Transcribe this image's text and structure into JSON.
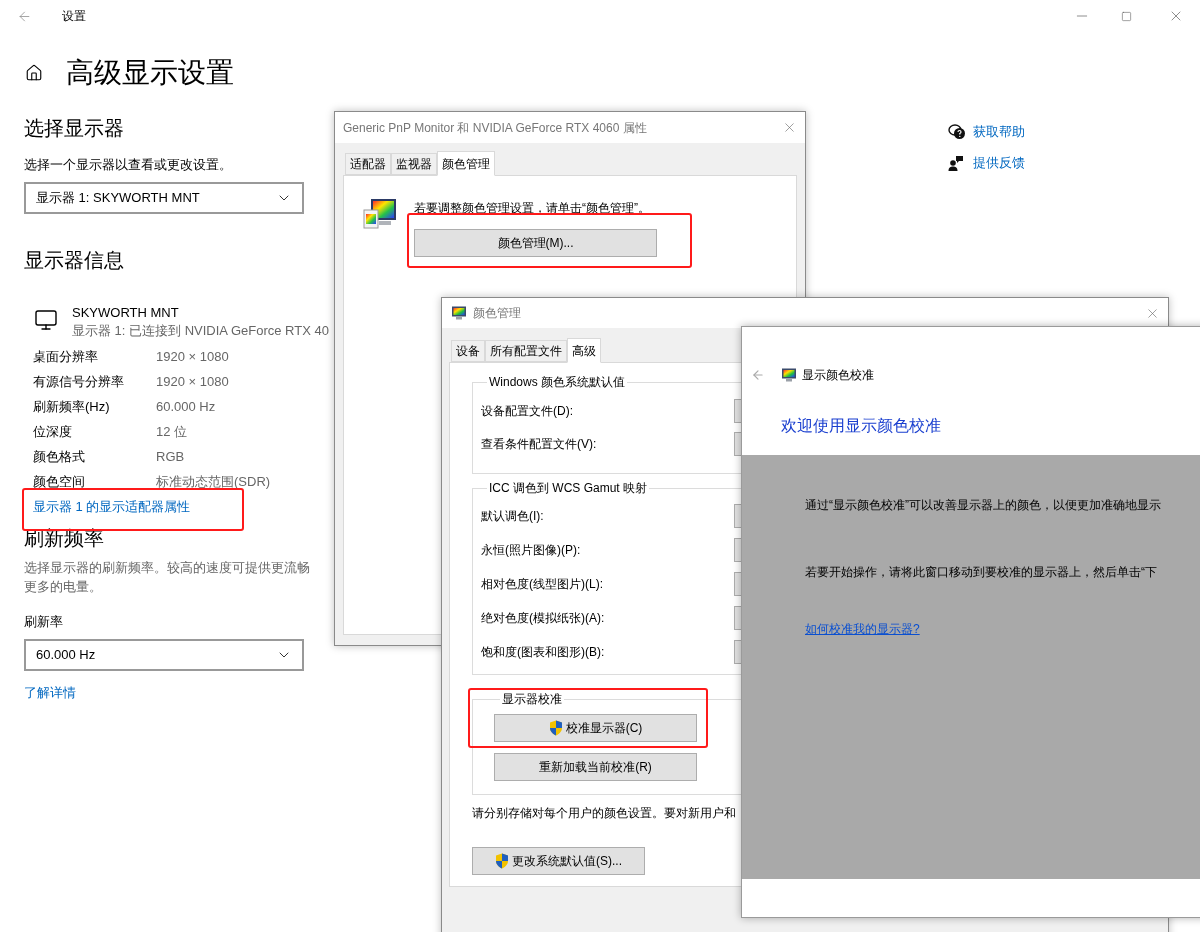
{
  "window": {
    "title": "设置"
  },
  "page": {
    "title": "高级显示设置"
  },
  "select_display": {
    "heading": "选择显示器",
    "label": "选择一个显示器以查看或更改设置。",
    "dropdown": {
      "value": "显示器 1: SKYWORTH MNT"
    }
  },
  "display_info": {
    "heading": "显示器信息",
    "monitor_name": "SKYWORTH MNT",
    "monitor_status": "显示器 1: 已连接到 NVIDIA GeForce RTX 40",
    "rows": [
      {
        "label": "桌面分辨率",
        "value": "1920 × 1080"
      },
      {
        "label": "有源信号分辨率",
        "value": "1920 × 1080"
      },
      {
        "label": "刷新频率(Hz)",
        "value": "60.000 Hz"
      },
      {
        "label": "位深度",
        "value": "12 位"
      },
      {
        "label": "颜色格式",
        "value": "RGB"
      },
      {
        "label": "颜色空间",
        "value": "标准动态范围(SDR)"
      }
    ],
    "adapter_link": {
      "text": "显示器 1 的显示适配器属性",
      "highlighted": true
    }
  },
  "refresh": {
    "heading": "刷新频率",
    "description_lines": [
      "选择显示器的刷新频率。较高的速度可提供更流畅",
      "更多的电量。"
    ],
    "rate_label": "刷新率",
    "dropdown": {
      "value": "60.000 Hz"
    },
    "learn_more": "了解详情"
  },
  "help_links": [
    {
      "kind": "help",
      "text": "获取帮助"
    },
    {
      "kind": "feedback",
      "text": "提供反馈"
    }
  ],
  "properties_dialog": {
    "title": "Generic PnP Monitor 和 NVIDIA GeForce RTX 4060 属性",
    "tabs": [
      {
        "label": "适配器",
        "selected": false
      },
      {
        "label": "监视器",
        "selected": false
      },
      {
        "label": "颜色管理",
        "selected": true
      }
    ],
    "instruction": "若要调整颜色管理设置，请单击“颜色管理”。",
    "button": {
      "label": "颜色管理(M)...",
      "highlighted": true
    }
  },
  "color_dialog": {
    "title": "颜色管理",
    "tabs": [
      {
        "label": "设备",
        "selected": false
      },
      {
        "label": "所有配置文件",
        "selected": false
      },
      {
        "label": "高级",
        "selected": true
      }
    ],
    "groups": [
      {
        "title": "Windows 颜色系统默认值",
        "rows": [
          "设备配置文件(D):",
          "查看条件配置文件(V):"
        ]
      },
      {
        "title": "ICC 调色到 WCS Gamut 映射",
        "rows": [
          "默认调色(I):",
          "永恒(照片图像)(P):",
          "相对色度(线型图片)(L):",
          "绝对色度(模拟纸张)(A):",
          "饱和度(图表和图形)(B):"
        ]
      }
    ],
    "calibration": {
      "title": "显示器校准",
      "highlighted": true,
      "buttons": [
        {
          "label": "校准显示器(C)",
          "shield": true
        },
        {
          "label": "重新加载当前校准(R)",
          "shield": false
        }
      ]
    },
    "note": "请分别存储对每个用户的颜色设置。要对新用户和",
    "defaults_button": {
      "label": "更改系统默认值(S)...",
      "shield": true
    }
  },
  "calibration_window": {
    "title": "显示颜色校准",
    "heading": "欢迎使用显示颜色校准",
    "paragraphs": [
      "通过“显示颜色校准”可以改善显示器上的颜色，以便更加准确地显示",
      "若要开始操作，请将此窗口移动到要校准的显示器上，然后单击“下"
    ],
    "link": "如何校准我的显示器?"
  }
}
